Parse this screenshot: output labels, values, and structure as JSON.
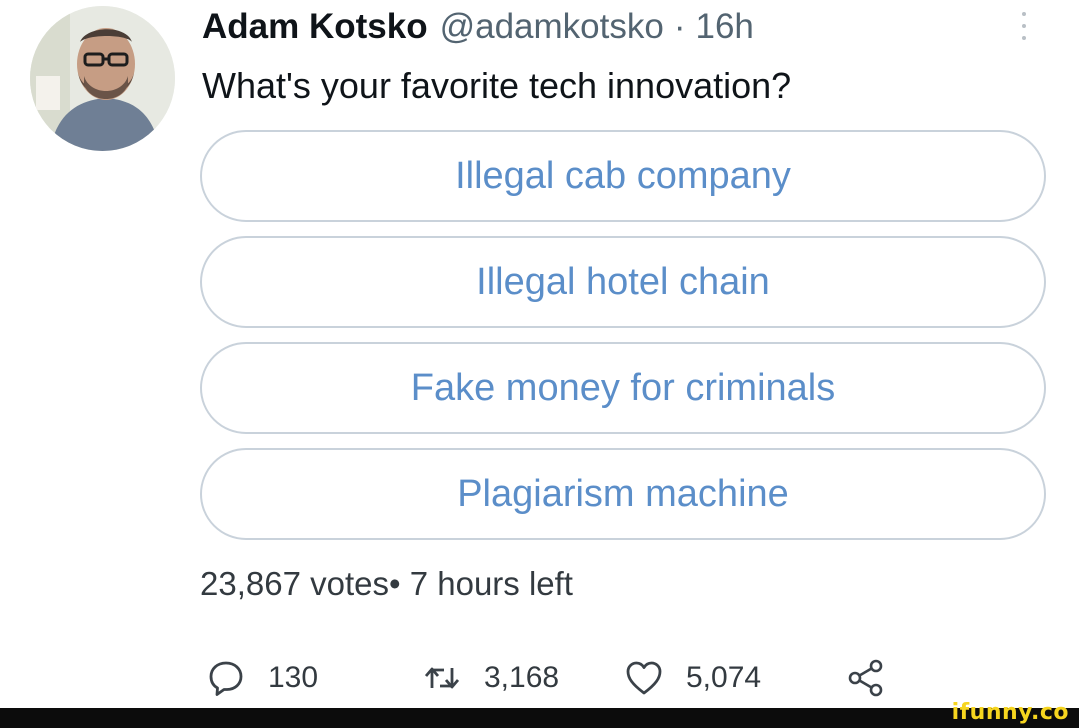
{
  "tweet": {
    "display_name": "Adam Kotsko",
    "handle": "@adamkotsko",
    "separator": "·",
    "time": "16h",
    "text": "What's your favorite tech innovation?"
  },
  "poll": {
    "options": [
      "Illegal cab company",
      "Illegal hotel chain",
      "Fake money for criminals",
      "Plagiarism machine"
    ],
    "votes": "23,867 votes",
    "meta_separator": "•",
    "time_left": "7 hours left"
  },
  "actions": {
    "replies": {
      "icon": "reply-icon",
      "count": "130"
    },
    "retweets": {
      "icon": "retweet-icon",
      "count": "3,168"
    },
    "likes": {
      "icon": "heart-icon",
      "count": "5,074"
    },
    "share": {
      "icon": "share-icon"
    }
  },
  "watermark": "ifunny.co",
  "colors": {
    "poll_text": "#5b8ec9",
    "poll_border": "#c9d2db",
    "secondary_text": "#536471",
    "watermark": "#f6d51f",
    "footer_bar": "#0c0c0c"
  }
}
